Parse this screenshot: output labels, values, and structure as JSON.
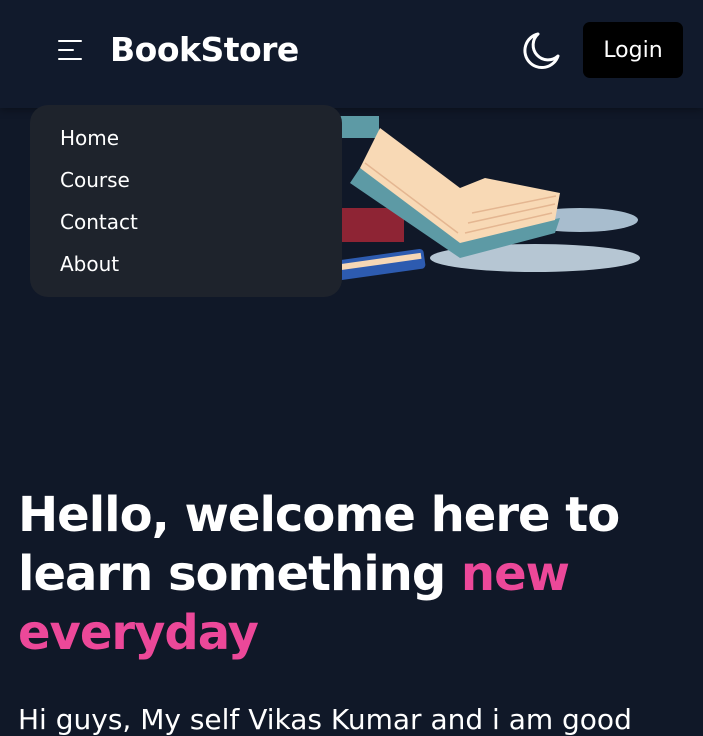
{
  "navbar": {
    "brand": "BookStore",
    "login_label": "Login",
    "menu_icon": "hamburger-icon",
    "theme_icon": "moon-icon"
  },
  "menu": {
    "items": [
      {
        "label": "Home"
      },
      {
        "label": "Course"
      },
      {
        "label": "Contact"
      },
      {
        "label": "About"
      }
    ]
  },
  "hero": {
    "headline_part1": "Hello, welcome here to learn something ",
    "headline_accent": "new everyday",
    "intro": "Hi guys, My self Vikas Kumar and i am good",
    "accent_color": "#ec4899",
    "image": "books-illustration"
  }
}
